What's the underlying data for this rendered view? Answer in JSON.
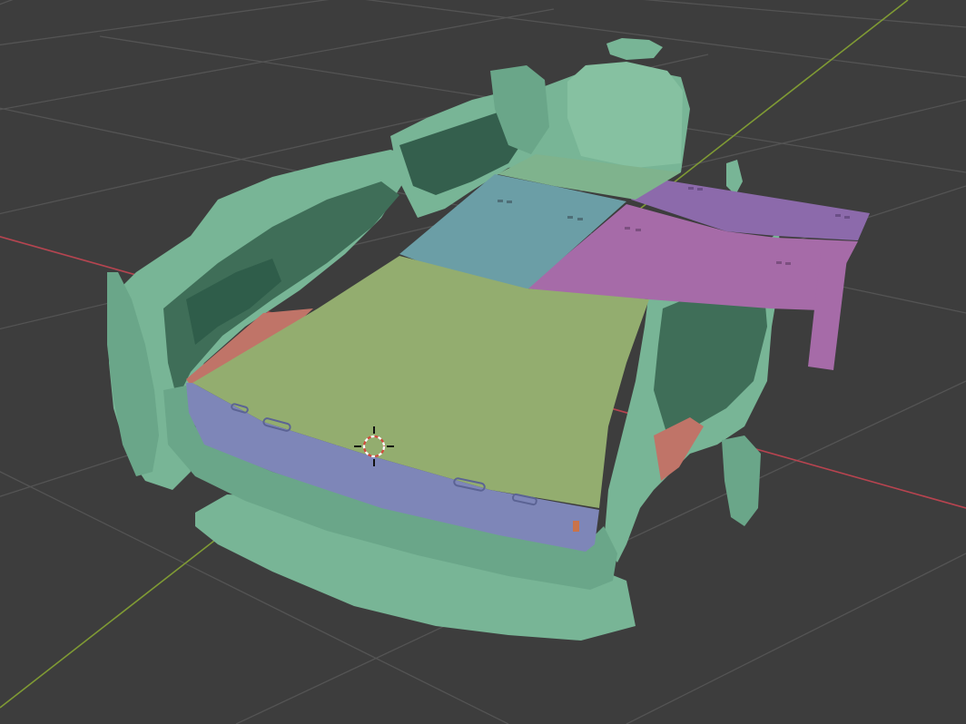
{
  "viewport": {
    "background_color": "#3d3d3d",
    "grid_color": "#545454",
    "axis_x_color": "#b8434f",
    "axis_y_color": "#7f9a34"
  },
  "scan_mesh": {
    "color": "#78b596",
    "shadow_color": "#2f5d4a",
    "highlight_color": "#9ad0b2"
  },
  "panels": {
    "front_green": "#93ad6f",
    "side_blue": "#7e86b8",
    "middle_blue": "#6b9ea6",
    "right_purple": "#a66ba8",
    "rear_purple": "#8c6aab",
    "left_red": "#c07468",
    "back_light_green": "#7fb38d"
  },
  "icons": {
    "cursor": "3d-cursor-icon"
  },
  "cursor_color": "#d24b3c"
}
